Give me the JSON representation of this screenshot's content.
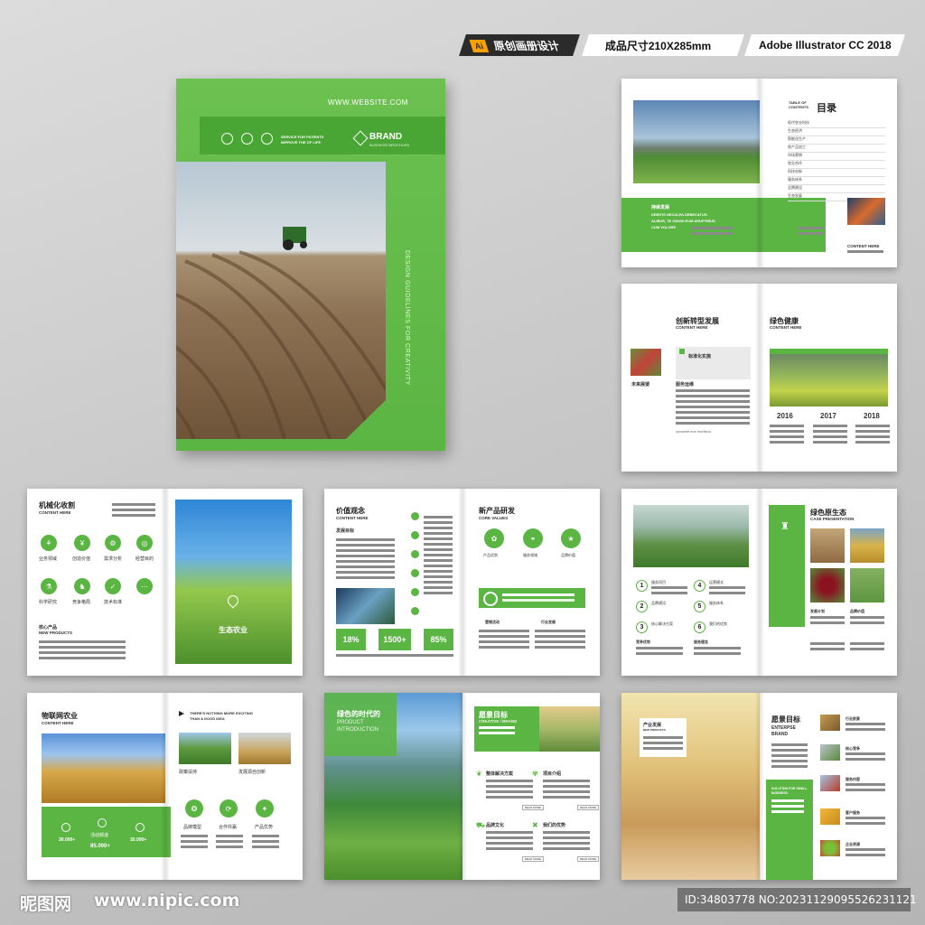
{
  "header": {
    "ai_badge": "Ai",
    "type_label": "原创画册设计",
    "size_label": "成品尺寸210X285mm",
    "software_label": "Adobe Illustrator CC 2018"
  },
  "cover": {
    "website": "WWW.WEBSITE.COM",
    "service": "SERVICE FOR PATIENTS",
    "improve": "IMPROVE THE OF LIFE",
    "brand": "BRAND",
    "brand_sub": "BUSINESS BROCHURE",
    "vertical": "DESIGN GUIDELINES FOR CREATIVITY"
  },
  "p1": {
    "toc_label": "TABLE OF CONTENTS",
    "toc_title": "目录",
    "toc_items": [
      "现代农业科技",
      "生态经济",
      "智能化生产",
      "农产品加工",
      "市场营销",
      "农业合作",
      "科技创新",
      "服务体系",
      "品牌建设",
      "生态发展"
    ],
    "green_heading": "持续发展",
    "green_text1": "DEBITIS NECULPA DEBECATUS.",
    "green_text2": "ALIBUS, TE ODION EUM ARUPTIBUS",
    "green_text3": "CUM VOLORE",
    "content_here": "CONTENT HERE"
  },
  "p2": {
    "left_title": "创新转型发展",
    "left_sub": "CONTENT HERE",
    "tag1": "标准化实施",
    "tag2": "未来展望",
    "tag3": "服务运维",
    "right_title": "绿色健康",
    "right_sub": "CONTENT HERE",
    "years": [
      "2016",
      "2017",
      "2018"
    ],
    "caption": "consetet ece modisno"
  },
  "p3": {
    "title": "机械化收割",
    "sub": "CONTENT HERE",
    "icons": [
      "业务领域",
      "创造价值",
      "需求分析",
      "经营目的",
      "科学研究",
      "竞争格局",
      "技术标准"
    ],
    "bottom_title": "核心产品",
    "bottom_sub": "NEW PRODUCTS",
    "overlay_text": "生态农业"
  },
  "p4": {
    "title": "价值观念",
    "sub": "CONTENT HERE",
    "label": "发展目标",
    "right_title": "新产品研发",
    "right_sub": "CORE VALUES",
    "stats": [
      "18%",
      "1500+",
      "85%"
    ],
    "tags": [
      "营销活动",
      "行业发展"
    ],
    "icon_labels": [
      "产品优势",
      "服务领域",
      "品牌价值"
    ]
  },
  "p5": {
    "title": "绿色原生态",
    "sub": "CASE PRESENTATION",
    "nums": [
      "1",
      "2",
      "3",
      "4",
      "5",
      "6"
    ],
    "labels": [
      "服务项目",
      "品牌建设",
      "核心解决方案",
      "运营模式",
      "服务体系",
      "我们的优势",
      "竞争优势",
      "服务理念",
      "发展计划",
      "品牌价值"
    ]
  },
  "p6": {
    "title": "物联网农业",
    "sub": "CONTENT HERE",
    "headline1": "THERE'S NOTHING MORE EXCITING",
    "headline2": "THAN A GOOD IDEA",
    "cap1": "政策扶持",
    "cap2": "发展源自创新",
    "icons": [
      "品牌模型",
      "合作共赢",
      "产品优势"
    ],
    "stats": [
      "30.000+",
      "85.000+",
      "30.000+"
    ],
    "stat_label": "活动频道"
  },
  "p7": {
    "title": "绿色的时代的",
    "sub1": "PRODUCT",
    "sub2": "INTRODUCTION",
    "right_title": "愿景目标",
    "right_sub": "CREATIVE / BRAND",
    "labels": [
      "整体解决方案",
      "项目介绍",
      "品牌文化",
      "我们的优势"
    ],
    "more": "READ MORE"
  },
  "p8": {
    "box_title": "产业发展",
    "box_sub": "NEW PRODUCTS",
    "title": "愿景目标",
    "sub1": "ENTERPSE",
    "sub2": "BRAND",
    "solution": "SOLUTION FOR SMALL BUSINESS",
    "items": [
      "行业前景",
      "核心竞争",
      "服务内容",
      "客户服务",
      "企业资源"
    ]
  },
  "footer": {
    "logo": "昵图网",
    "url": "www.nipic.com",
    "id_text": "ID:34803778 NO:20231129095526231121"
  },
  "colors": {
    "green": "#5bb543",
    "light_green": "#8fd06f",
    "dark": "#222222"
  }
}
